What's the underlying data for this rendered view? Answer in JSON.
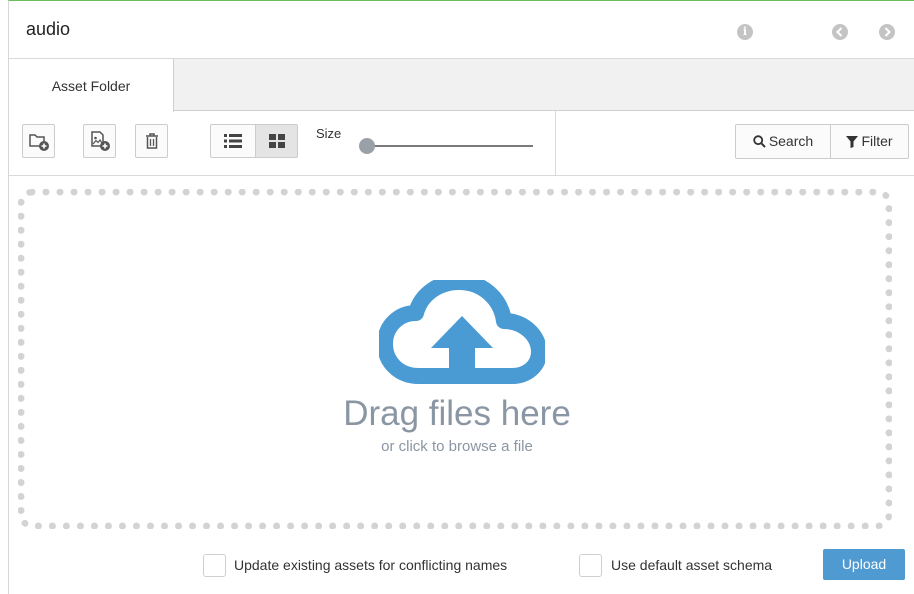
{
  "header": {
    "title": "audio",
    "info_icon": "info-icon",
    "back_icon": "arrow-left-circle-icon",
    "forward_icon": "arrow-right-circle-icon"
  },
  "tabs": [
    {
      "label": "Asset Folder",
      "active": true
    }
  ],
  "toolbar": {
    "size_label": "Size",
    "size_slider_value": 0,
    "search_label": "Search",
    "filter_label": "Filter",
    "icons": [
      "new-folder-icon",
      "new-asset-icon",
      "trash-icon",
      "list-view-icon",
      "grid-view-icon",
      "search-icon",
      "filter-icon"
    ]
  },
  "dropzone": {
    "title": "Drag files here",
    "subtitle": "or click to browse a file",
    "icon": "cloud-upload-icon"
  },
  "footer": {
    "conflict_label": "Update existing assets for conflicting names",
    "conflict_checked": false,
    "schema_label": "Use default asset schema",
    "schema_checked": false,
    "upload_label": "Upload"
  },
  "colors": {
    "accent": "#4f9bd1",
    "cloud": "#4a9ad4",
    "drop_text": "#8a96a3",
    "dropzone_border": "#d3d3d3",
    "top_border": "#6bbf5a"
  }
}
